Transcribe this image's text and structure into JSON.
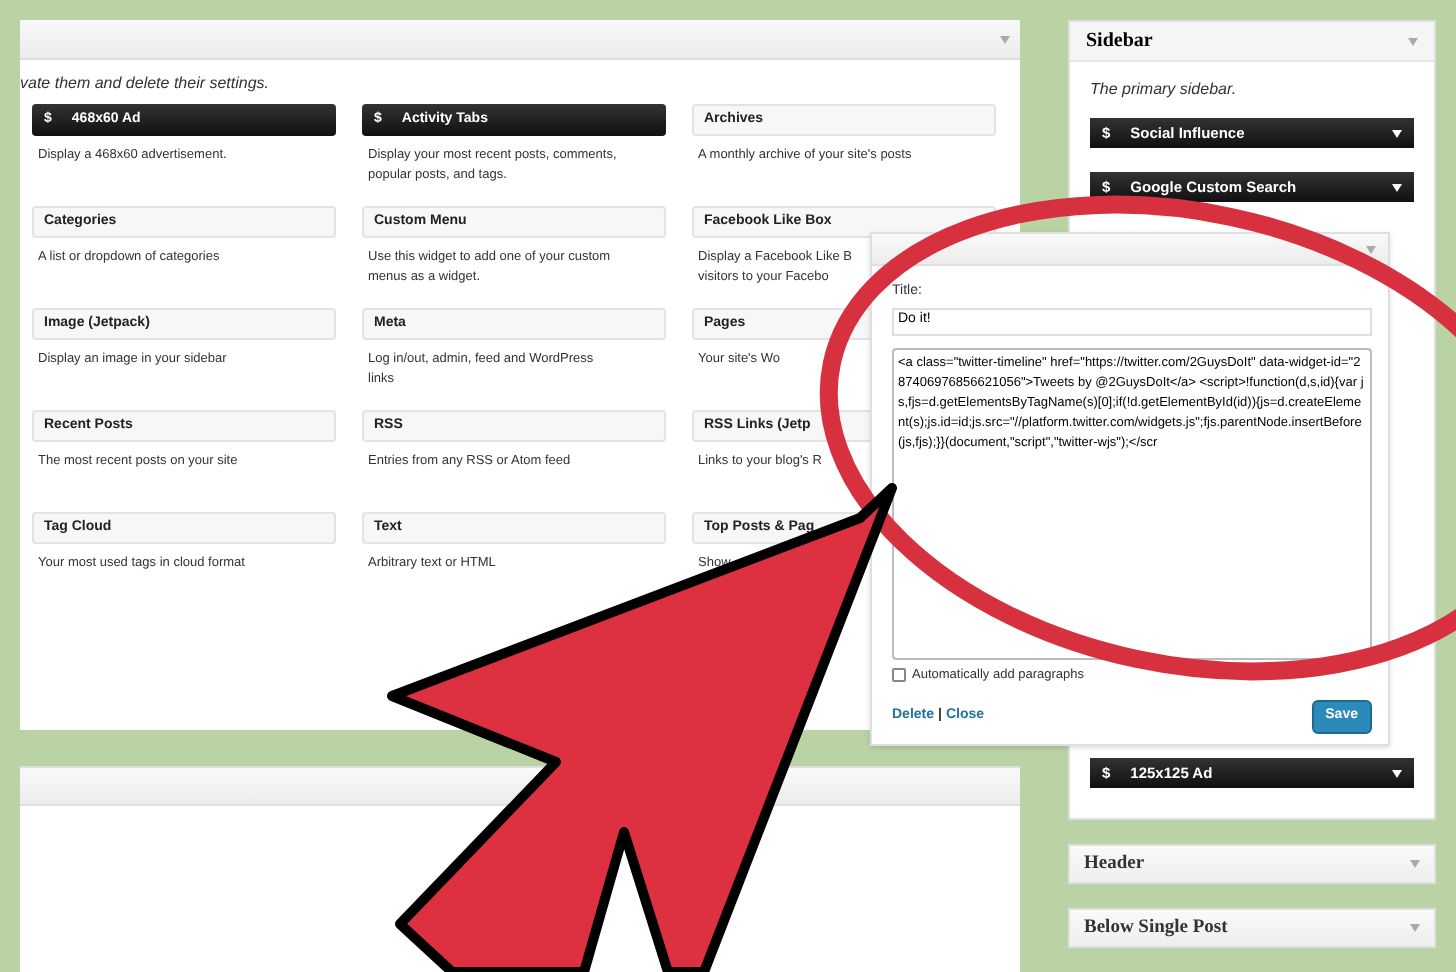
{
  "main_panel": {
    "intro": "vate them and delete their settings."
  },
  "widgets": [
    {
      "title": "468x60 Ad",
      "kind": "dark",
      "icon": "$",
      "lines": [
        "Display a 468x60 advertisement."
      ]
    },
    {
      "title": "Activity Tabs",
      "kind": "dark",
      "icon": "$",
      "lines": [
        "Display your most recent posts, comments,",
        "popular posts, and tags."
      ]
    },
    {
      "title": "Archives",
      "kind": "plain",
      "lines": [
        "A monthly archive of your site's posts"
      ]
    },
    {
      "title": "Categories",
      "kind": "plain",
      "lines": [
        "A list or dropdown of categories"
      ]
    },
    {
      "title": "Custom Menu",
      "kind": "plain",
      "lines": [
        "Use this widget to add one of your custom",
        "menus as a widget."
      ]
    },
    {
      "title": "Facebook Like Box",
      "kind": "plain",
      "lines": [
        "Display a Facebook Like B",
        "visitors to your Facebo"
      ]
    },
    {
      "title": "Image (Jetpack)",
      "kind": "plain",
      "lines": [
        "Display an image in your sidebar"
      ]
    },
    {
      "title": "Meta",
      "kind": "plain",
      "lines": [
        "Log in/out, admin, feed and WordPress",
        "links"
      ]
    },
    {
      "title": "Pages",
      "kind": "plain",
      "lines": [
        "Your site's Wo"
      ]
    },
    {
      "title": "Recent Posts",
      "kind": "plain",
      "lines": [
        "The most recent posts on your site"
      ]
    },
    {
      "title": "RSS",
      "kind": "plain",
      "lines": [
        "Entries from any RSS or Atom feed"
      ]
    },
    {
      "title": "RSS Links (Jetp",
      "kind": "plain",
      "lines": [
        "Links to your blog's R"
      ]
    },
    {
      "title": "Tag Cloud",
      "kind": "plain",
      "lines": [
        "Your most used tags in cloud format"
      ]
    },
    {
      "title": "Text",
      "kind": "plain",
      "lines": [
        "Arbitrary text or HTML"
      ]
    },
    {
      "title": "Top Posts & Pag",
      "kind": "plain",
      "lines": [
        "Show"
      ]
    }
  ],
  "sidebar": {
    "title": "Sidebar",
    "description": "The primary sidebar.",
    "widgets_above": [
      {
        "icon": "$",
        "label": "Social Influence"
      },
      {
        "icon": "$",
        "label": "Google Custom Search"
      }
    ],
    "widgets_below": [
      {
        "icon": "$",
        "label": "125x125 Ad"
      }
    ]
  },
  "edit_widget": {
    "title_label": "Title:",
    "title_value": "Do it!",
    "content": "<a class=\"twitter-timeline\" href=\"https://twitter.com/2GuysDoIt\" data-widget-id=\"287406976856621056\">Tweets by @2GuysDoIt</a> <script>!function(d,s,id){var js,fjs=d.getElementsByTagName(s)[0];if(!d.getElementById(id)){js=d.createElement(s);js.id=id;js.src=\"//platform.twitter.com/widgets.js\";fjs.parentNode.insertBefore(js,fjs);}}(document,\"script\",\"twitter-wjs\");</scr",
    "auto_paragraphs": {
      "label": "Automatically add paragraphs",
      "checked": false
    },
    "delete_link": "Delete",
    "separator": "|",
    "close_link": "Close",
    "save_button": "Save"
  },
  "other_areas": [
    {
      "title": "Header"
    },
    {
      "title": "Below Single Post"
    }
  ]
}
